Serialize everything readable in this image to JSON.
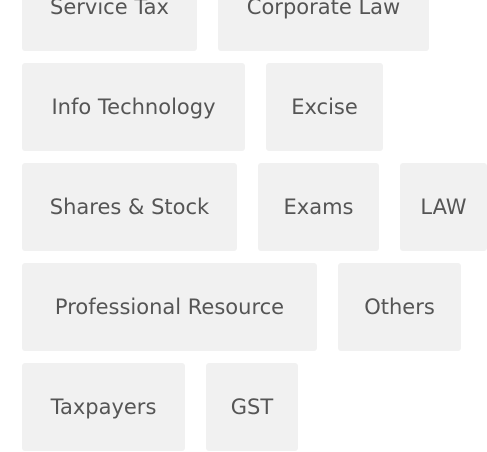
{
  "tags": [
    "Service Tax",
    "Corporate Law",
    "Info Technology",
    "Excise",
    "Shares & Stock",
    "Exams",
    "LAW",
    "Professional Resource",
    "Others",
    "Taxpayers",
    "GST"
  ],
  "colors": {
    "tag_background": "#f1f1f1",
    "tag_text": "#555555"
  }
}
